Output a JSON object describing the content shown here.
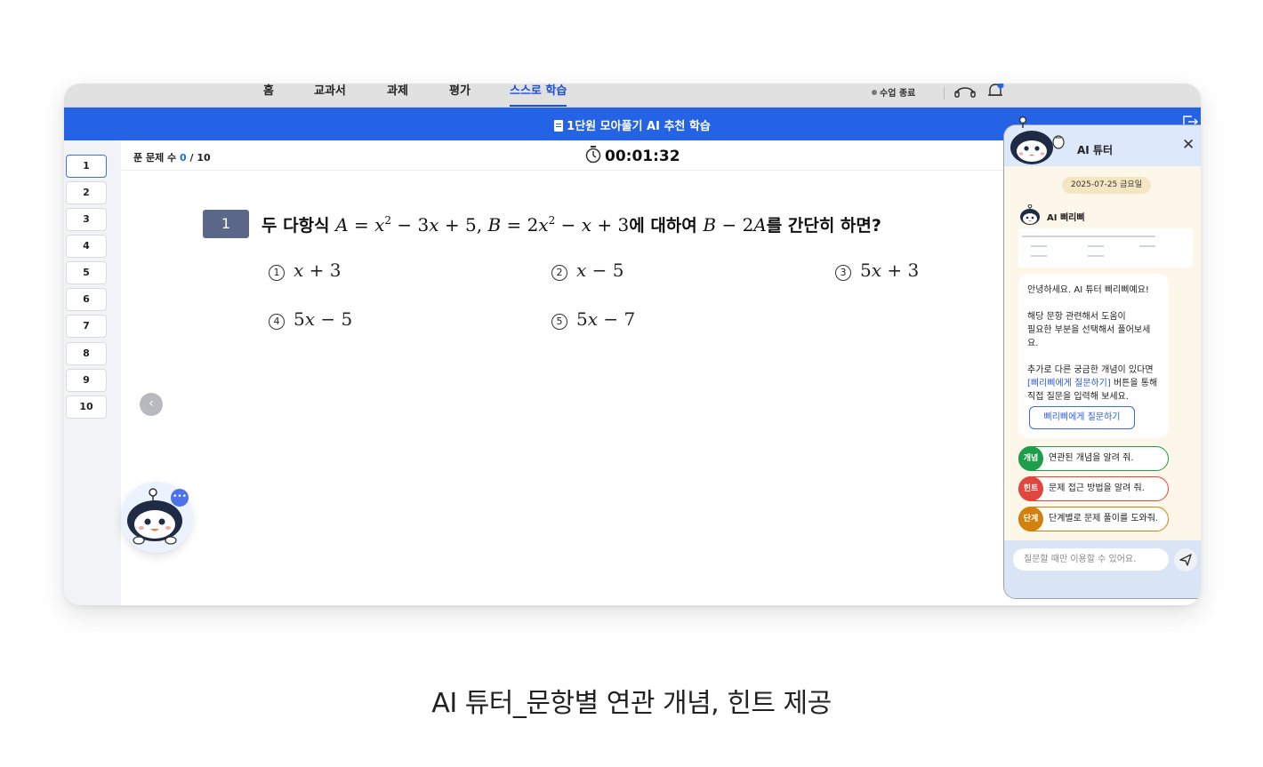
{
  "nav": {
    "items": [
      "홈",
      "교과서",
      "과제",
      "평가",
      "스스로 학습"
    ],
    "class_status": "수업 종료"
  },
  "titlebar": {
    "title": "1단원 모아풀기 AI 추천 학습"
  },
  "sidebar": {
    "numbers": [
      "1",
      "2",
      "3",
      "4",
      "5",
      "6",
      "7",
      "8",
      "9",
      "10"
    ]
  },
  "infobar": {
    "solved_label": "푼 문제 수",
    "solved_count": "0",
    "total": "/ 10",
    "timer": "00:01:32"
  },
  "question": {
    "number": "1",
    "prefix": "두 다항식",
    "mid": "에 대하여",
    "suffix": "를 간단히 하면?",
    "choices": [
      {
        "marker": "①",
        "expr": "x + 3"
      },
      {
        "marker": "②",
        "expr": "x − 5"
      },
      {
        "marker": "③",
        "expr": "5x + 3"
      },
      {
        "marker": "④",
        "expr": "5x − 5"
      },
      {
        "marker": "⑤",
        "expr": "5x − 7"
      }
    ]
  },
  "tutor": {
    "title": "AI 튜터",
    "date": "2025-07-25 금요일",
    "bot_name": "AI 삐리삐",
    "greeting": "안녕하세요. AI 튜터 삐리삐예요!",
    "line1a": "해당 문항 관련해서 도움이",
    "line1b": "필요한 부분을 선택해서 풀어보세요.",
    "line2a": "추가로 다른 궁금한 개념이 있다면",
    "line2_link": "[삐리삐에게 질문하기]",
    "line2_rest": " 버튼을 통해",
    "line2c": "직접 질문을 입력해 보세요.",
    "ask_button": "삐리삐에게 질문하기",
    "quick": [
      {
        "tag": "개념",
        "label": "연관된 개념을 알려 줘.",
        "color": "#1e9e4a"
      },
      {
        "tag": "힌트",
        "label": "문제 접근 방법을 알려 줘.",
        "color": "#e2453c"
      },
      {
        "tag": "단계",
        "label": "단계별로 문제 풀이를 도와줘.",
        "color": "#d4800e"
      }
    ],
    "input_placeholder": "질문할 때만 이용할 수 있어요."
  },
  "caption": "AI 튜터_문항별 연관 개념, 힌트 제공",
  "colors": {
    "primary": "#2563e6",
    "active_nav": "#1f4fd1",
    "tutor_bg": "#fdf7ea"
  }
}
